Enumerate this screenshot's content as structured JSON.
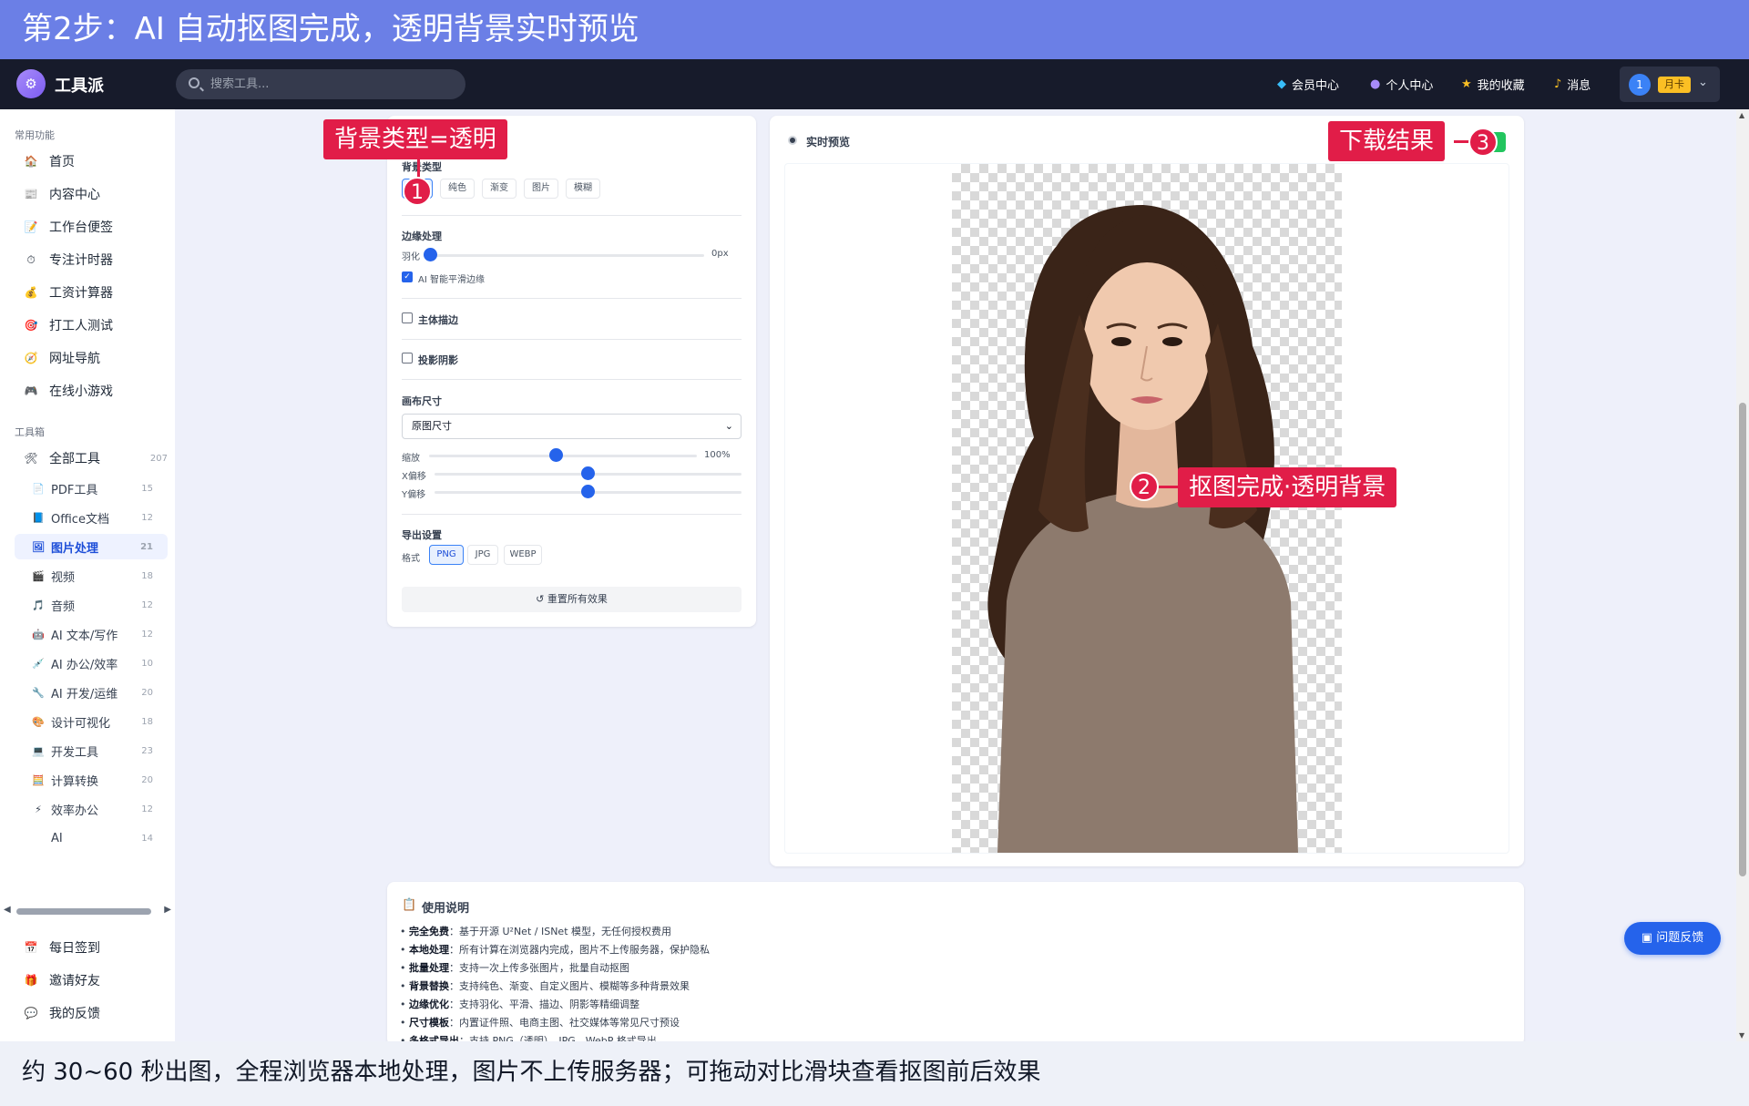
{
  "banner": {
    "text": "第2步：AI 自动抠图完成，透明背景实时预览"
  },
  "caption": {
    "text": "约 30~60 秒出图，全程浏览器本地处理，图片不上传服务器；可拖动对比滑块查看抠图前后效果"
  },
  "topbar": {
    "brand": "工具派",
    "search_placeholder": "搜索工具...",
    "links": [
      {
        "label": "会员中心",
        "icon": "diamond-icon"
      },
      {
        "label": "个人中心",
        "icon": "user-icon"
      },
      {
        "label": "我的收藏",
        "icon": "star-icon"
      },
      {
        "label": "消息",
        "icon": "bell-icon"
      }
    ],
    "user": {
      "avatar": "1",
      "badge": "月卡"
    }
  },
  "sidebar": {
    "common_title": "常用功能",
    "common": [
      {
        "label": "首页",
        "icon": "🏠"
      },
      {
        "label": "内容中心",
        "icon": "📰"
      },
      {
        "label": "工作台便签",
        "icon": "📝"
      },
      {
        "label": "专注计时器",
        "icon": "⏱"
      },
      {
        "label": "工资计算器",
        "icon": "💰"
      },
      {
        "label": "打工人测试",
        "icon": "🎯"
      },
      {
        "label": "网址导航",
        "icon": "🧭"
      },
      {
        "label": "在线小游戏",
        "icon": "🎮"
      }
    ],
    "tools_title": "工具箱",
    "all_tools": {
      "label": "全部工具",
      "count": "207",
      "icon": "🛠"
    },
    "categories": [
      {
        "label": "PDF工具",
        "count": "15",
        "icon": "📄"
      },
      {
        "label": "Office文档",
        "count": "12",
        "icon": "📘"
      },
      {
        "label": "图片处理",
        "count": "21",
        "icon": "🖼"
      },
      {
        "label": "视频",
        "count": "18",
        "icon": "🎬"
      },
      {
        "label": "音频",
        "count": "12",
        "icon": "🎵"
      },
      {
        "label": "AI 文本/写作",
        "count": "12",
        "icon": "🤖"
      },
      {
        "label": "AI 办公/效率",
        "count": "10",
        "icon": "💉"
      },
      {
        "label": "AI 开发/运维",
        "count": "20",
        "icon": "🔧"
      },
      {
        "label": "设计可视化",
        "count": "18",
        "icon": "🎨"
      },
      {
        "label": "开发工具",
        "count": "23",
        "icon": "💻"
      },
      {
        "label": "计算转换",
        "count": "20",
        "icon": "🧮"
      },
      {
        "label": "效率办公",
        "count": "12",
        "icon": "⚡"
      },
      {
        "label": "AI",
        "count": "14",
        "icon": ""
      }
    ],
    "bottom": [
      {
        "label": "每日签到",
        "icon": "📅"
      },
      {
        "label": "邀请好友",
        "icon": "🎁"
      },
      {
        "label": "我的反馈",
        "icon": "💬"
      }
    ]
  },
  "settings": {
    "bg_type_label": "背景类型",
    "bg_types": [
      "透明",
      "纯色",
      "渐变",
      "图片",
      "模糊"
    ],
    "edge_label": "边缘处理",
    "feather_label": "羽化",
    "feather_value": "0px",
    "feather_fraction": 0,
    "ai_smooth_label": "AI 智能平滑边缘",
    "outline_label": "主体描边",
    "shadow_label": "投影阴影",
    "canvas_label": "画布尺寸",
    "canvas_select": "原图尺寸",
    "scale_label": "缩放",
    "scale_value": "100%",
    "x_offset_label": "X偏移",
    "y_offset_label": "Y偏移",
    "export_label": "导出设置",
    "format_label": "格式",
    "formats": [
      "PNG",
      "JPG",
      "WEBP"
    ],
    "reset_label": "↺ 重置所有效果"
  },
  "preview": {
    "title": "实时预览"
  },
  "annotations": {
    "a1": "背景类型=透明",
    "a2": "抠图完成·透明背景",
    "a3": "下载结果",
    "n1": "1",
    "n2": "2",
    "n3": "3"
  },
  "usage": {
    "title": "使用说明",
    "items": [
      {
        "key": "完全免费",
        "text": "：基于开源 U²Net / ISNet 模型，无任何授权费用"
      },
      {
        "key": "本地处理",
        "text": "：所有计算在浏览器内完成，图片不上传服务器，保护隐私"
      },
      {
        "key": "批量处理",
        "text": "：支持一次上传多张图片，批量自动抠图"
      },
      {
        "key": "背景替换",
        "text": "：支持纯色、渐变、自定义图片、模糊等多种背景效果"
      },
      {
        "key": "边缘优化",
        "text": "：支持羽化、平滑、描边、阴影等精细调整"
      },
      {
        "key": "尺寸模板",
        "text": "：内置证件照、电商主图、社交媒体等常见尺寸预设"
      },
      {
        "key": "多格式导出",
        "text": "：支持 PNG（透明）、JPG、WebP 格式导出"
      }
    ]
  },
  "feedback": {
    "label": "问题反馈"
  }
}
